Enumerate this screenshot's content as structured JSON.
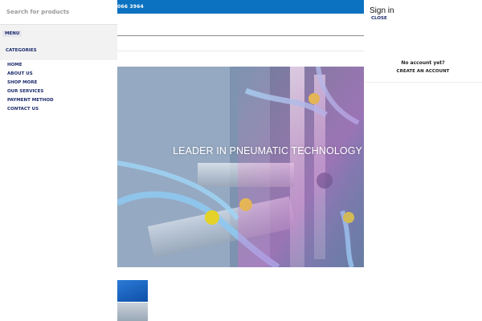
{
  "topbar": {
    "phone": "066 3964"
  },
  "search": {
    "placeholder": "Search for products"
  },
  "menu": {
    "tab_label": "MENU",
    "categories_label": "CATEGORIES",
    "items": [
      {
        "label": "HOME"
      },
      {
        "label": "ABOUT US"
      },
      {
        "label": "SHOP MORE"
      },
      {
        "label": "OUR SERVICES"
      },
      {
        "label": "PAYMENT METHOD"
      },
      {
        "label": "CONTACT US"
      }
    ]
  },
  "hero": {
    "title": "LEADER IN PNEUMATIC TECHNOLOGY"
  },
  "account": {
    "title": "Sign in",
    "close_label": "CLOSE",
    "no_account": "No account yet?",
    "create_account": "CREATE AN ACCOUNT"
  },
  "colors": {
    "topbar": "#0a72c0",
    "nav_text": "#1b2a6b",
    "menu_bg": "#f2f2f2"
  }
}
